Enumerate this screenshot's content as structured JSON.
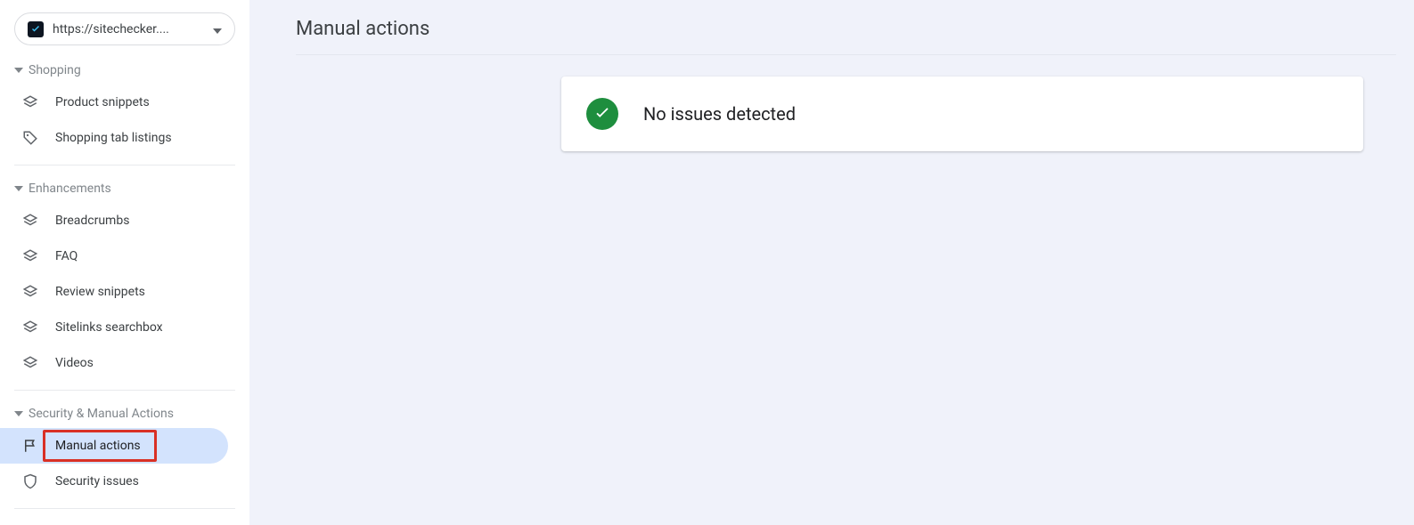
{
  "property": {
    "url": "https://sitechecker...."
  },
  "sidebar": {
    "sections": [
      {
        "title": "Shopping",
        "items": [
          {
            "label": "Product snippets",
            "icon": "layers"
          },
          {
            "label": "Shopping tab listings",
            "icon": "tag"
          }
        ]
      },
      {
        "title": "Enhancements",
        "items": [
          {
            "label": "Breadcrumbs",
            "icon": "layers"
          },
          {
            "label": "FAQ",
            "icon": "layers"
          },
          {
            "label": "Review snippets",
            "icon": "layers"
          },
          {
            "label": "Sitelinks searchbox",
            "icon": "layers"
          },
          {
            "label": "Videos",
            "icon": "layers"
          }
        ]
      },
      {
        "title": "Security & Manual Actions",
        "items": [
          {
            "label": "Manual actions",
            "icon": "flag",
            "active": true,
            "highlighted": true
          },
          {
            "label": "Security issues",
            "icon": "shield"
          }
        ]
      }
    ]
  },
  "main": {
    "title": "Manual actions",
    "status_message": "No issues detected"
  }
}
